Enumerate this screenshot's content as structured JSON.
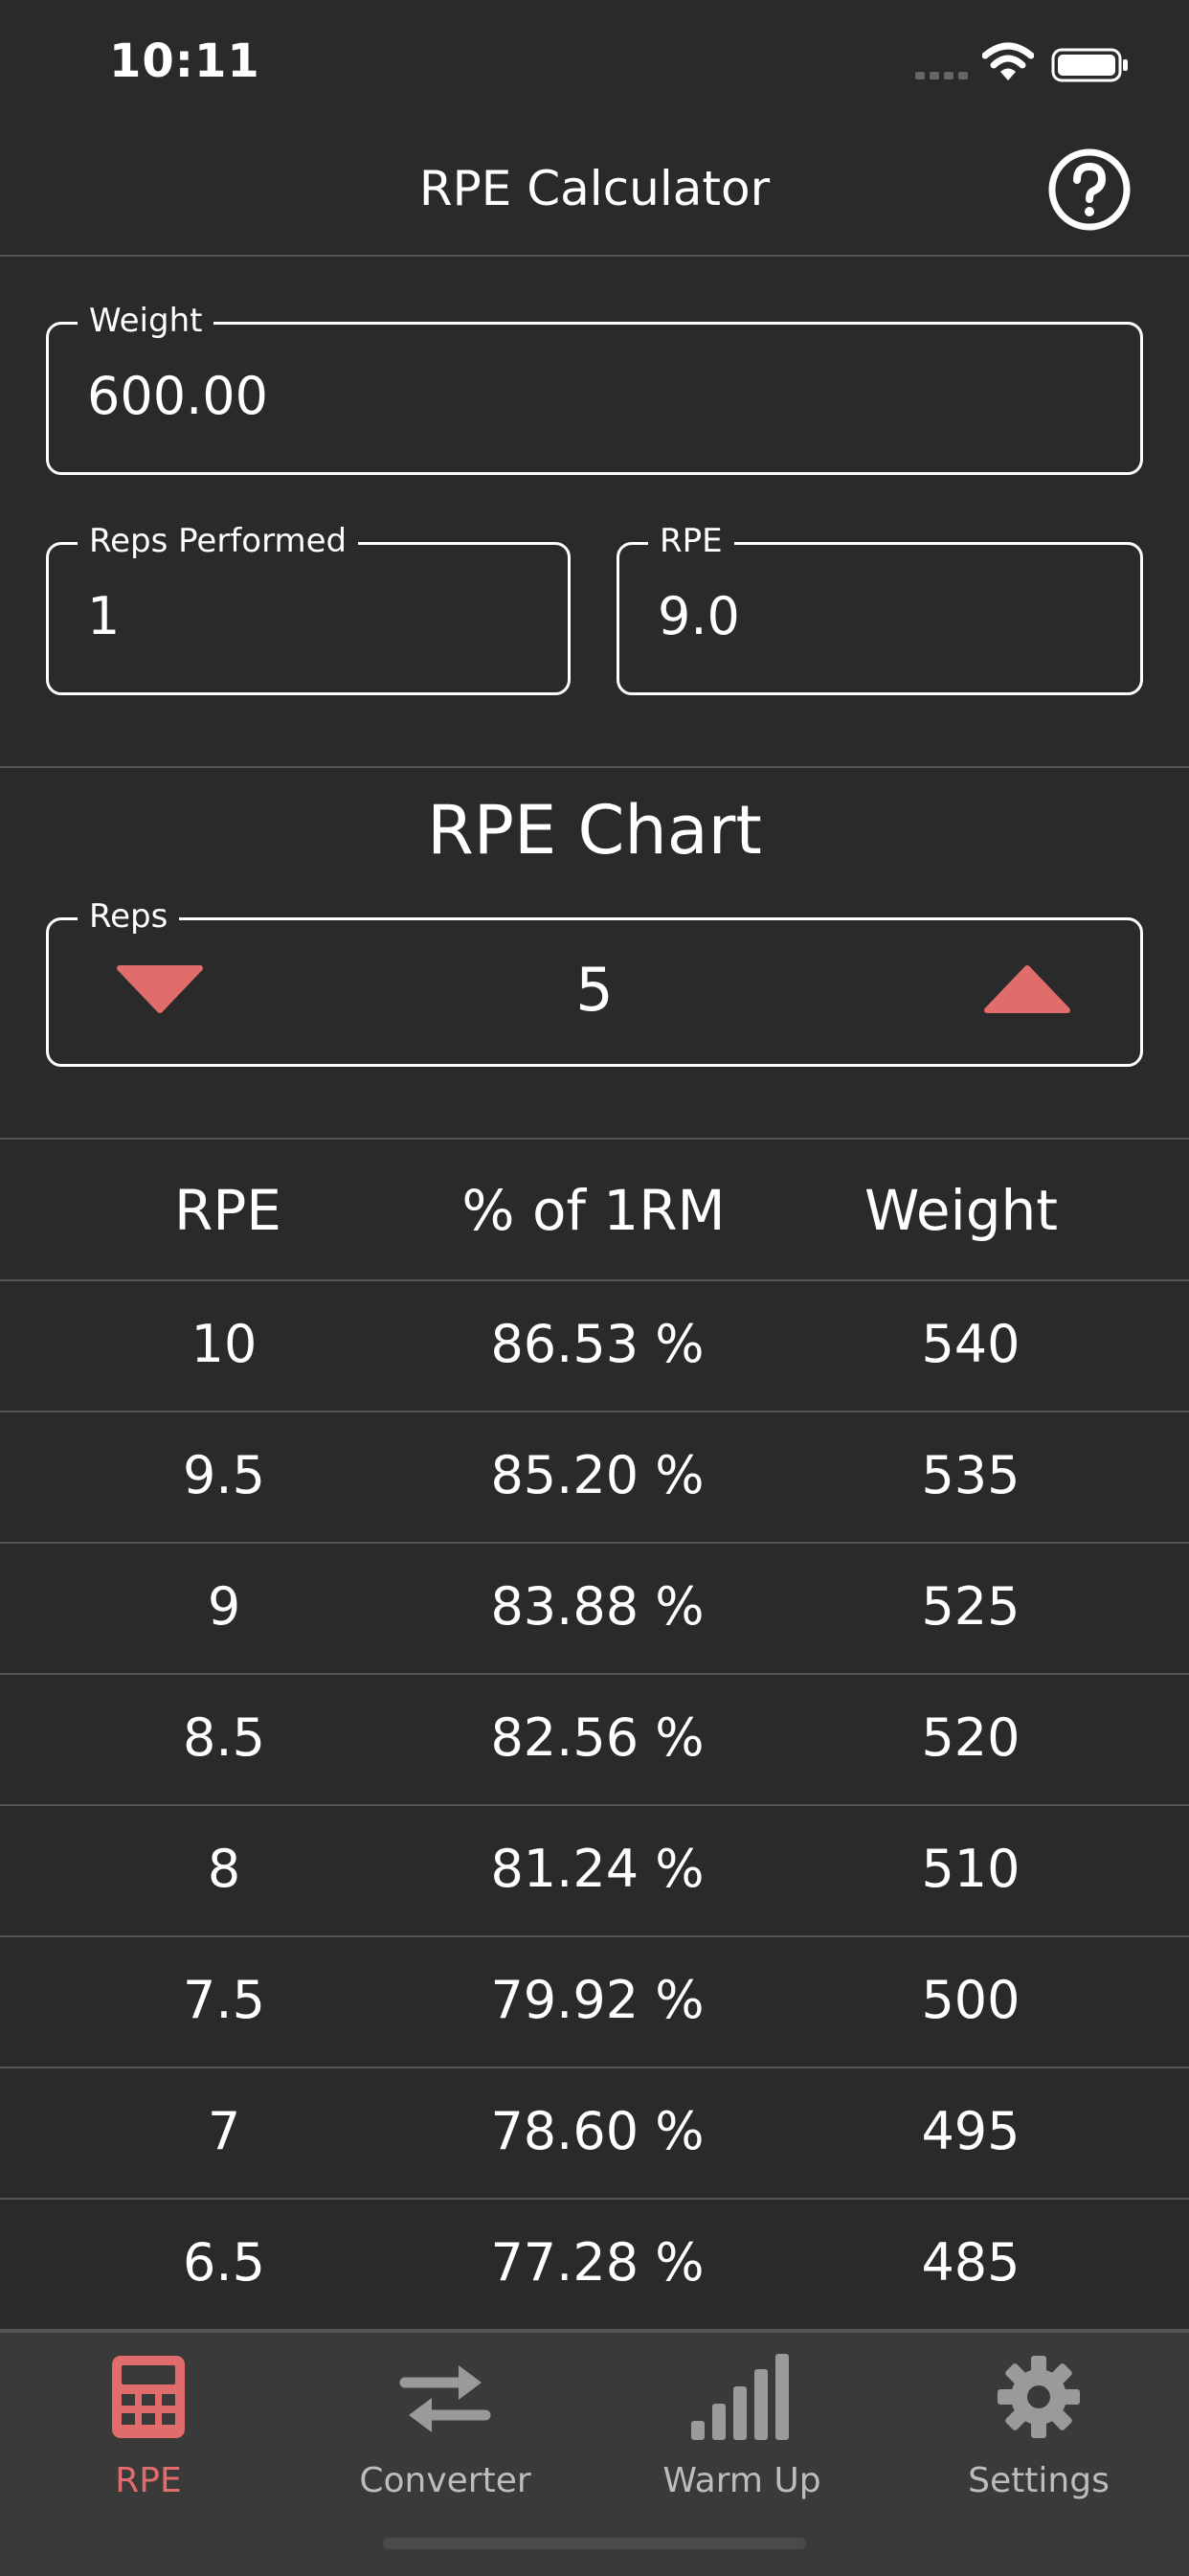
{
  "status": {
    "time": "10:11"
  },
  "nav": {
    "title": "RPE Calculator",
    "help_icon": "question-circle-icon"
  },
  "inputs": {
    "weight": {
      "label": "Weight",
      "value": "600.00"
    },
    "reps": {
      "label": "Reps Performed",
      "value": "1"
    },
    "rpe": {
      "label": "RPE",
      "value": "9.0"
    }
  },
  "chart": {
    "title": "RPE Chart",
    "reps_stepper": {
      "label": "Reps",
      "value": "5"
    },
    "accent": "#e06c6c"
  },
  "table": {
    "headers": [
      "RPE",
      "% of 1RM",
      "Weight"
    ],
    "rows": [
      [
        "10",
        "86.53 %",
        "540"
      ],
      [
        "9.5",
        "85.20 %",
        "535"
      ],
      [
        "9",
        "83.88 %",
        "525"
      ],
      [
        "8.5",
        "82.56 %",
        "520"
      ],
      [
        "8",
        "81.24 %",
        "510"
      ],
      [
        "7.5",
        "79.92 %",
        "500"
      ],
      [
        "7",
        "78.60 %",
        "495"
      ],
      [
        "6.5",
        "77.28 %",
        "485"
      ]
    ]
  },
  "tabs": [
    {
      "label": "RPE",
      "icon": "calculator-icon",
      "active": true
    },
    {
      "label": "Converter",
      "icon": "swap-arrows-icon",
      "active": false
    },
    {
      "label": "Warm Up",
      "icon": "signal-bars-icon",
      "active": false
    },
    {
      "label": "Settings",
      "icon": "gear-icon",
      "active": false
    }
  ]
}
